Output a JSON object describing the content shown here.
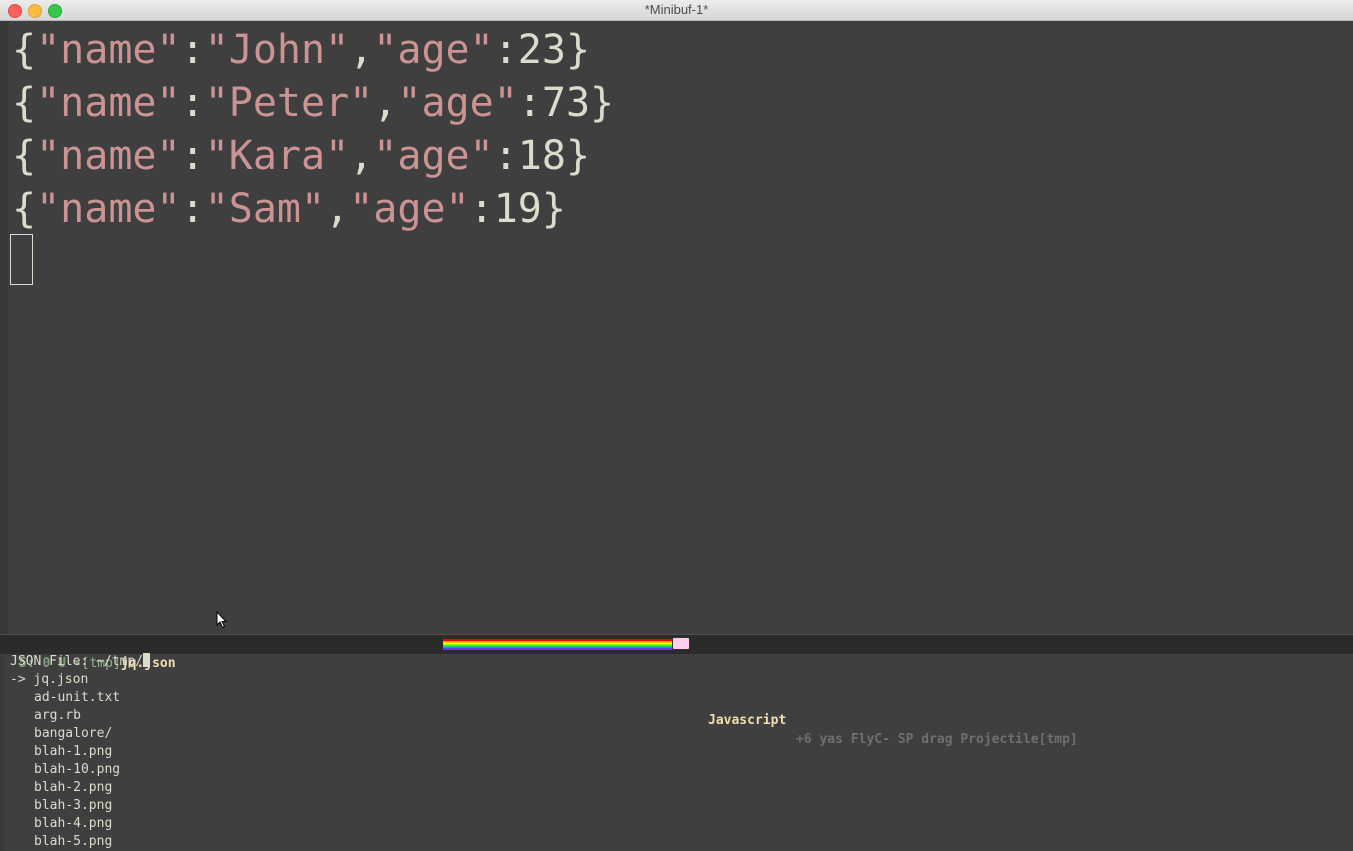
{
  "window": {
    "title": "*Minibuf-1*"
  },
  "editor": {
    "lines": [
      {
        "k1": "name",
        "v1": "John",
        "k2": "age",
        "v2": "23"
      },
      {
        "k1": "name",
        "v1": "Peter",
        "k2": "age",
        "v2": "73"
      },
      {
        "k1": "name",
        "v1": "Kara",
        "k2": "age",
        "v2": "18"
      },
      {
        "k1": "name",
        "v1": "Sam",
        "k2": "age",
        "v2": "19"
      }
    ]
  },
  "modeline": {
    "position": "5: 0",
    "state": "U -",
    "directory": "[tmp]",
    "buffer": "jq.json",
    "major_mode": "Javascript",
    "minor_modes": "+6 yas FlyC- SP drag Projectile[tmp]"
  },
  "minibuffer": {
    "prompt": "JSON File: ~/tmp/",
    "selected_prefix": "-> ",
    "selected": "jq.json",
    "items": [
      "ad-unit.txt",
      "arg.rb",
      "bangalore/",
      "blah-1.png",
      "blah-10.png",
      "blah-2.png",
      "blah-3.png",
      "blah-4.png",
      "blah-5.png"
    ]
  }
}
